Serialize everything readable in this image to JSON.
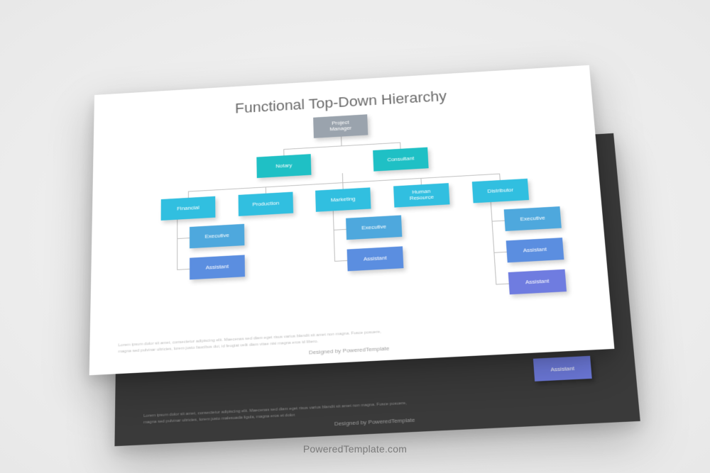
{
  "watermark": "PoweredTemplate.com",
  "front": {
    "title": "Functional Top-Down Hierarchy",
    "lorem": "Lorem ipsum dolor sit amet, consectetur adipiscing elit. Maecenas sed diam eget risus varius blandit sit amet non magna. Fusce posuere, magna sed pulvinar ultricies, lorem justo faucibus dui, id feugiat velit diam vitae nisi magna eros id libero.",
    "designed": "Designed by PoweredTemplate",
    "nodes": {
      "pm": "Project\nManager",
      "notary": "Notary",
      "consultant": "Consultant",
      "financial": "Financial",
      "production": "Production",
      "marketing": "Marketing",
      "hr": "Human\nResource",
      "distributor": "Distributor",
      "exec1": "Executive",
      "asst1": "Assistant",
      "exec2": "Executive",
      "asst2": "Assistant",
      "exec3": "Executive",
      "asst3": "Assistant",
      "asst4": "Assistant"
    }
  },
  "back": {
    "lorem": "Lorem ipsum dolor sit amet, consectetur adipiscing elit. Maecenas sed diam eget risus varius blandit sit amet non magna. Fusce posuere, magna sed pulvinar ultricies, lorem justo malesuada ligula, magna eros et dolor.",
    "designed": "Designed by PoweredTemplate",
    "node": "Assistant"
  },
  "chart_data": {
    "type": "hierarchy",
    "title": "Functional Top-Down Hierarchy",
    "root": {
      "label": "Project Manager",
      "children": [
        {
          "label": "Notary"
        },
        {
          "label": "Consultant"
        },
        {
          "label": "Financial",
          "children": [
            {
              "label": "Executive"
            },
            {
              "label": "Assistant"
            }
          ]
        },
        {
          "label": "Production"
        },
        {
          "label": "Marketing",
          "children": [
            {
              "label": "Executive"
            },
            {
              "label": "Assistant"
            }
          ]
        },
        {
          "label": "Human Resource"
        },
        {
          "label": "Distributor",
          "children": [
            {
              "label": "Executive"
            },
            {
              "label": "Assistant"
            },
            {
              "label": "Assistant"
            }
          ]
        }
      ]
    }
  }
}
